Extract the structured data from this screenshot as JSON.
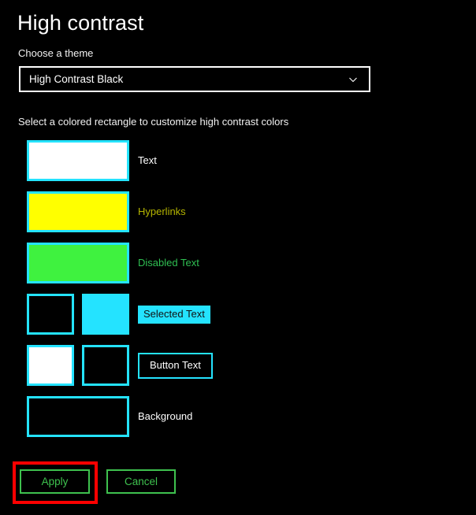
{
  "page": {
    "title": "High contrast"
  },
  "theme": {
    "label": "Choose a theme",
    "selected": "High Contrast Black",
    "chevron_icon": "chevron-down-icon"
  },
  "instruction": "Select a colored rectangle to customize high contrast colors",
  "colors": {
    "background": "#000000",
    "accent_border": "#24e3ff",
    "text_white": "#ffffff",
    "hyperlink_yellow": "#b5b500",
    "disabled_green": "#2fbf52",
    "button_green": "#3ec14e",
    "highlight_red": "#fe0000"
  },
  "swatch_rows": [
    {
      "name": "text",
      "label": "Text",
      "label_style": "plain",
      "swatches": [
        {
          "fill": "#ffffff"
        }
      ]
    },
    {
      "name": "hyperlinks",
      "label": "Hyperlinks",
      "label_style": "link",
      "swatches": [
        {
          "fill": "#ffff00"
        }
      ]
    },
    {
      "name": "disabled-text",
      "label": "Disabled Text",
      "label_style": "disabled",
      "swatches": [
        {
          "fill": "#3ff23f"
        }
      ]
    },
    {
      "name": "selected-text",
      "label": "Selected Text",
      "label_style": "selected",
      "swatches": [
        {
          "fill": "#000000"
        },
        {
          "fill": "#24e3ff"
        }
      ]
    },
    {
      "name": "button-text",
      "label": "Button Text",
      "label_style": "buttonlike",
      "swatches": [
        {
          "fill": "#ffffff"
        },
        {
          "fill": "#000000"
        }
      ]
    },
    {
      "name": "background",
      "label": "Background",
      "label_style": "plain",
      "swatches": [
        {
          "fill": "#000000"
        }
      ]
    }
  ],
  "actions": {
    "apply_label": "Apply",
    "cancel_label": "Cancel"
  }
}
